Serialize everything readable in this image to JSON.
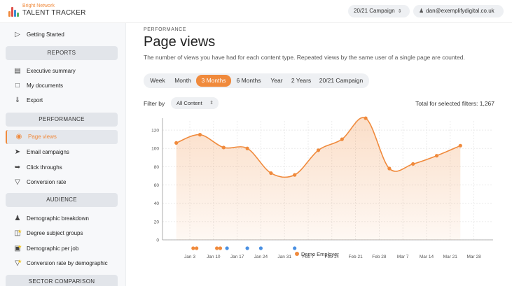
{
  "header": {
    "brand_top": "Bright Network",
    "brand_name": "TALENT TRACKER",
    "campaign": "20/21 Campaign",
    "user": "dan@exemplifydigital.co.uk"
  },
  "sidebar": {
    "getting_started": "Getting Started",
    "sections": {
      "reports": "REPORTS",
      "performance": "PERFORMANCE",
      "audience": "AUDIENCE",
      "sector": "SECTOR COMPARISON"
    },
    "reports_items": [
      "Executive summary",
      "My documents",
      "Export"
    ],
    "performance_items": [
      "Page views",
      "Email campaigns",
      "Click throughs",
      "Conversion rate"
    ],
    "audience_items": [
      "Demographic breakdown",
      "Degree subject groups",
      "Demographic per job",
      "Conversion rate by demographic"
    ]
  },
  "main": {
    "eyebrow": "PERFORMANCE",
    "title": "Page views",
    "description": "The number of views you have had for each content type. Repeated views by the same user of a single page are counted.",
    "tabs": [
      "Week",
      "Month",
      "3 Months",
      "6 Months",
      "Year",
      "2 Years",
      "20/21 Campaign"
    ],
    "active_tab": "3 Months",
    "filter_label": "Filter by",
    "filter_value": "All Content",
    "total": "Total for selected filters: 1,267"
  },
  "colors": {
    "accent": "#f08a3c",
    "event_blue": "#4a90e2",
    "event_orange": "#f08a3c"
  },
  "chart_data": {
    "type": "area",
    "x_ticks": [
      "Jan 3",
      "Jan 10",
      "Jan 17",
      "Jan 24",
      "Jan 31",
      "Feb 7",
      "Feb 14",
      "Feb 21",
      "Feb 28",
      "Mar 7",
      "Mar 14",
      "Mar 21",
      "Mar 28"
    ],
    "y_ticks": [
      "0",
      "20",
      "40",
      "60",
      "80",
      "100",
      "120"
    ],
    "ylim": [
      0,
      130
    ],
    "grid": true,
    "legend_position": "bottom",
    "series": [
      {
        "name": "Demo Employer",
        "points": [
          {
            "x": "Dec 30",
            "y": 106
          },
          {
            "x": "Jan 6",
            "y": 115
          },
          {
            "x": "Jan 13",
            "y": 101
          },
          {
            "x": "Jan 20",
            "y": 100
          },
          {
            "x": "Jan 27",
            "y": 73
          },
          {
            "x": "Feb 3",
            "y": 71
          },
          {
            "x": "Feb 10",
            "y": 98
          },
          {
            "x": "Feb 17",
            "y": 110
          },
          {
            "x": "Feb 24",
            "y": 133
          },
          {
            "x": "Mar 3",
            "y": 78
          },
          {
            "x": "Mar 10",
            "y": 83
          },
          {
            "x": "Mar 17",
            "y": 92
          },
          {
            "x": "Mar 24",
            "y": 103
          }
        ]
      }
    ],
    "events": [
      {
        "x": "Jan 4",
        "color": "orange"
      },
      {
        "x": "Jan 5",
        "color": "orange"
      },
      {
        "x": "Jan 11",
        "color": "orange"
      },
      {
        "x": "Jan 12",
        "color": "orange"
      },
      {
        "x": "Jan 14",
        "color": "blue"
      },
      {
        "x": "Jan 20",
        "color": "blue"
      },
      {
        "x": "Jan 24",
        "color": "blue"
      },
      {
        "x": "Feb 3",
        "color": "blue"
      }
    ]
  }
}
